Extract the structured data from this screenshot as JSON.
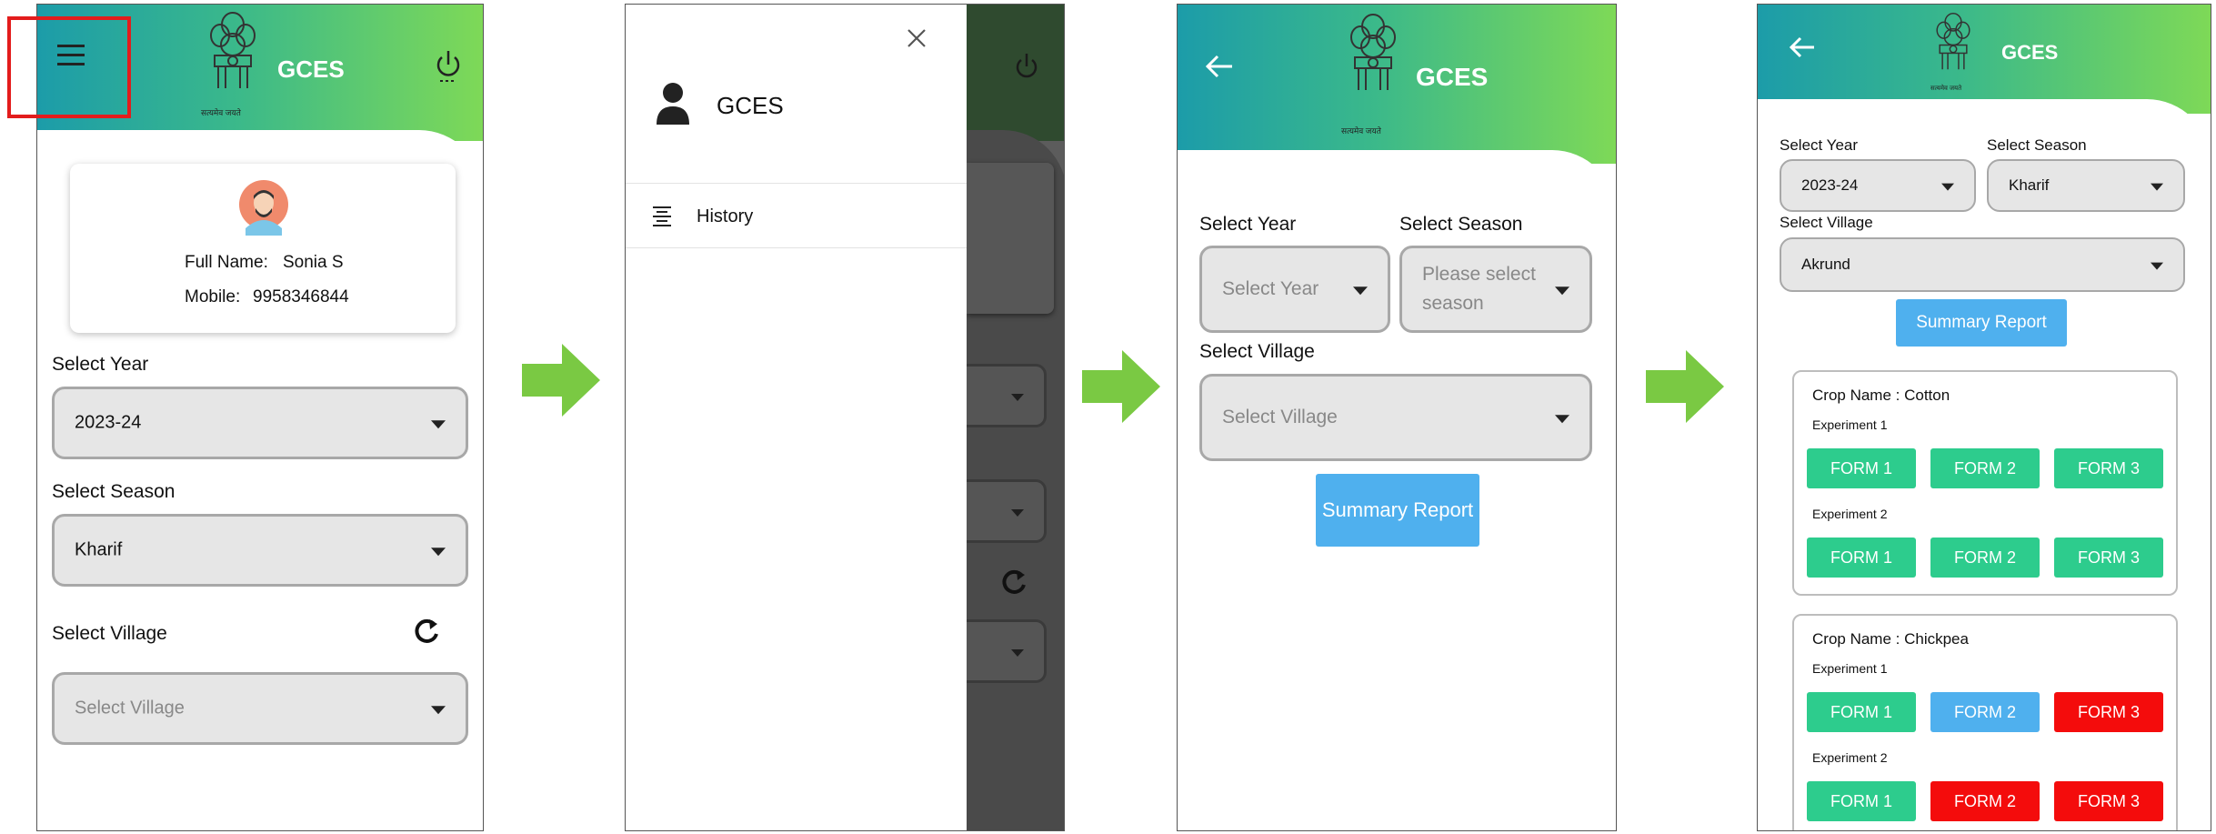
{
  "s1": {
    "app_title": "GCES",
    "emblem_caption": "सत्यमेव जयते",
    "profile": {
      "name_label": "Full Name:",
      "name_value": "Sonia S",
      "mobile_label": "Mobile:",
      "mobile_value": "9958346844"
    },
    "year_label": "Select Year",
    "year_value": "2023-24",
    "season_label": "Select Season",
    "season_value": "Kharif",
    "village_label": "Select Village",
    "village_placeholder": "Select Village"
  },
  "s2": {
    "app_title": "GCES",
    "menu_items": [
      {
        "label": "History"
      }
    ]
  },
  "s3": {
    "app_title": "GCES",
    "emblem_caption": "सत्यमेव जयते",
    "year_label": "Select Year",
    "year_placeholder": "Select Year",
    "season_label": "Select Season",
    "season_placeholder": "Please select season",
    "village_label": "Select Village",
    "village_placeholder": "Select Village",
    "summary_button": "Summary Report"
  },
  "s4": {
    "app_title": "GCES",
    "emblem_caption": "सत्यमेव जयते",
    "year_label": "Select Year",
    "year_value": "2023-24",
    "season_label": "Select Season",
    "season_value": "Kharif",
    "village_label": "Select Village",
    "village_value": "Akrund",
    "summary_button": "Summary Report",
    "crops": [
      {
        "title": "Crop Name : Cotton",
        "experiments": [
          {
            "label": "Experiment 1",
            "forms": [
              {
                "label": "FORM 1",
                "status": "green"
              },
              {
                "label": "FORM 2",
                "status": "green"
              },
              {
                "label": "FORM 3",
                "status": "green"
              }
            ]
          },
          {
            "label": "Experiment 2",
            "forms": [
              {
                "label": "FORM 1",
                "status": "green"
              },
              {
                "label": "FORM 2",
                "status": "green"
              },
              {
                "label": "FORM 3",
                "status": "green"
              }
            ]
          }
        ]
      },
      {
        "title": "Crop Name : Chickpea",
        "experiments": [
          {
            "label": "Experiment 1",
            "forms": [
              {
                "label": "FORM 1",
                "status": "green"
              },
              {
                "label": "FORM 2",
                "status": "blue"
              },
              {
                "label": "FORM 3",
                "status": "red"
              }
            ]
          },
          {
            "label": "Experiment 2",
            "forms": [
              {
                "label": "FORM 1",
                "status": "green"
              },
              {
                "label": "FORM 2",
                "status": "red"
              },
              {
                "label": "FORM 3",
                "status": "red"
              }
            ]
          }
        ]
      }
    ]
  },
  "colors": {
    "header_start": "#1c9ca9",
    "header_end": "#7ed957",
    "highlight": "#e31c1c",
    "flow_arrow": "#7ac943",
    "form_green": "#2dcc8d",
    "form_blue": "#4fb0ee",
    "form_red": "#f40c0c",
    "summary_blue": "#4fb0ee"
  }
}
